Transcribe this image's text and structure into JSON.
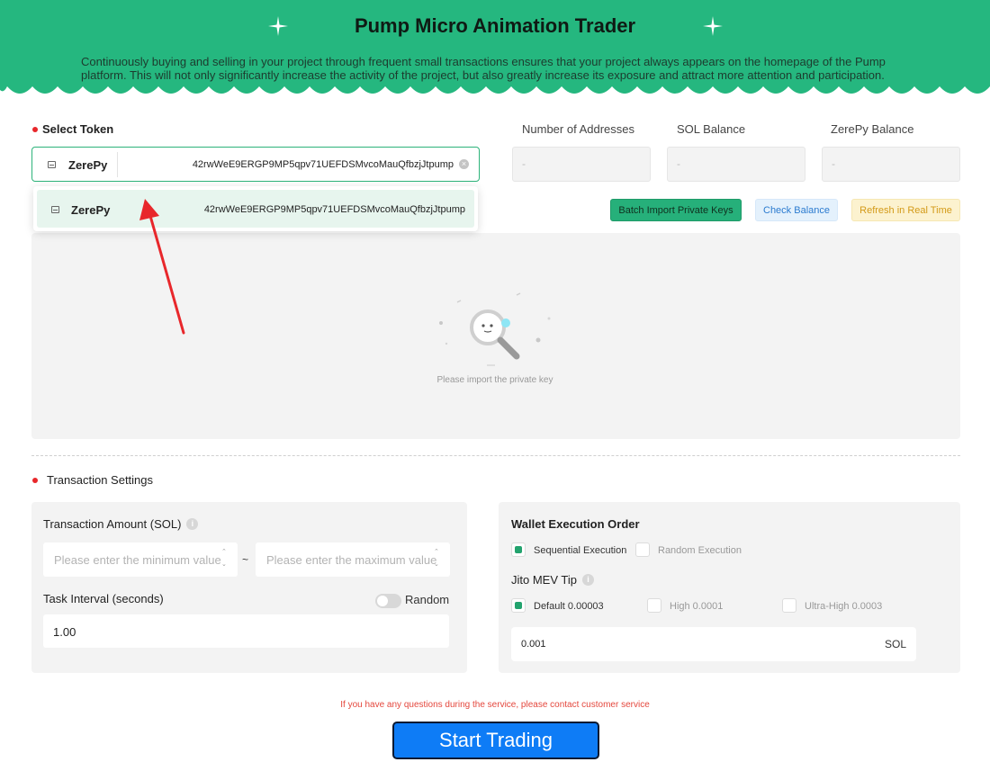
{
  "header": {
    "title": "Pump Micro Animation Trader",
    "description": "Continuously buying and selling in your project through frequent small transactions ensures that your project always appears on the homepage of the Pump platform. This will not only significantly increase the activity of the project, but also greatly increase its exposure and attract more attention and participation.",
    "accent_color": "#25b77f"
  },
  "token": {
    "label": "Select Token",
    "selected_name": "ZerePy",
    "selected_address": "42rwWeE9ERGP9MP5qpv71UEFDSMvcoMauQfbzjJtpump",
    "options": [
      {
        "name": "ZerePy",
        "address": "42rwWeE9ERGP9MP5qpv71UEFDSMvcoMauQfbzjJtpump"
      }
    ]
  },
  "stats": [
    {
      "label": "Number of Addresses",
      "value": "-"
    },
    {
      "label": "SOL Balance",
      "value": "-"
    },
    {
      "label": "ZerePy Balance",
      "value": "-"
    }
  ],
  "actions": {
    "batch_import": "Batch Import Private Keys",
    "check_balance": "Check Balance",
    "refresh": "Refresh in Real Time"
  },
  "empty_state": {
    "text": "Please import the private key"
  },
  "transaction_settings": {
    "title": "Transaction Settings",
    "amount_label": "Transaction Amount (SOL)",
    "min_placeholder": "Please enter the minimum value",
    "max_placeholder": "Please enter the maximum value",
    "range_separator": "~",
    "interval_label": "Task Interval (seconds)",
    "random_label": "Random",
    "random_enabled": false,
    "interval_value": "1.00"
  },
  "wallet": {
    "order_label": "Wallet Execution Order",
    "sequential_label": "Sequential Execution",
    "random_label": "Random Execution",
    "jito_label": "Jito MEV Tip",
    "tip_default": "Default 0.00003",
    "tip_high": "High 0.0001",
    "tip_ultra": "Ultra-High 0.0003",
    "tip_value": "0.001",
    "tip_unit": "SOL"
  },
  "footer": {
    "contact_text": "If you have any questions during the service, please contact customer service",
    "start_button": "Start Trading"
  }
}
